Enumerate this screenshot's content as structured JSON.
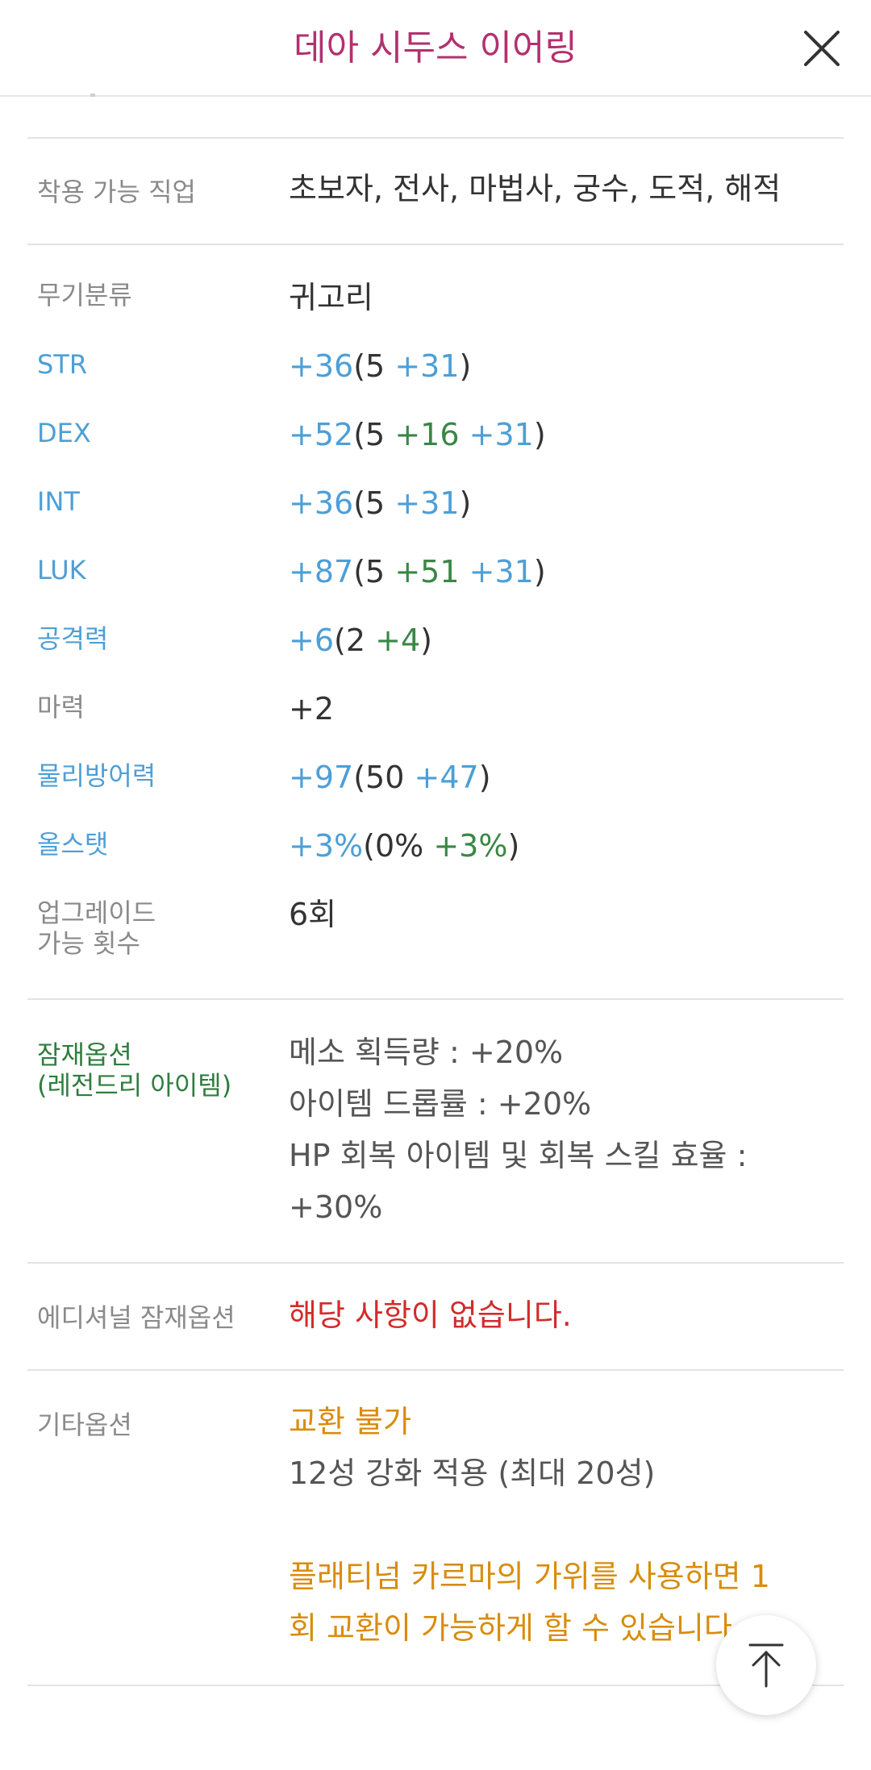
{
  "header": {
    "title": "데아 시두스 이어링"
  },
  "jobs": {
    "label": "착용 가능 직업",
    "value": "초보자, 전사, 마법사, 궁수, 도적, 해적"
  },
  "weapon_type": {
    "label": "무기분류",
    "value": "귀고리"
  },
  "str": {
    "label": "STR",
    "total": "+36",
    "open": "(",
    "base": "5",
    "bonus1": "+31",
    "close": ")"
  },
  "dex": {
    "label": "DEX",
    "total": "+52",
    "open": "(",
    "base": "5",
    "bonus_green": "+16",
    "bonus_blue": "+31",
    "close": ")"
  },
  "int": {
    "label": "INT",
    "total": "+36",
    "open": "(",
    "base": "5",
    "bonus1": "+31",
    "close": ")"
  },
  "luk": {
    "label": "LUK",
    "total": "+87",
    "open": "(",
    "base": "5",
    "bonus_green": "+51",
    "bonus_blue": "+31",
    "close": ")"
  },
  "attack": {
    "label": "공격력",
    "total": "+6",
    "open": "(",
    "base": "2",
    "bonus_green": "+4",
    "close": ")"
  },
  "magic": {
    "label": "마력",
    "value": "+2"
  },
  "defense": {
    "label": "물리방어력",
    "total": "+97",
    "open": "(",
    "base": "50",
    "bonus_blue": "+47",
    "close": ")"
  },
  "allstat": {
    "label": "올스탯",
    "total": "+3%",
    "open": "(",
    "base": "0%",
    "bonus_green": "+3%",
    "close": ")"
  },
  "upgrade": {
    "label_line1": "업그레이드",
    "label_line2": "가능 횟수",
    "value": "6회"
  },
  "potential": {
    "label_line1": "잠재옵션",
    "label_line2": "(레전드리 아이템)",
    "lines": [
      "메소 획득량 : +20%",
      "아이템 드롭률 : +20%",
      "HP 회복 아이템 및 회복 스킬 효율 :",
      "+30%"
    ]
  },
  "additional": {
    "label": "에디셔널 잠재옵션",
    "value": "해당 사항이 없습니다."
  },
  "etc": {
    "label": "기타옵션",
    "trade": "교환 불가",
    "star": "12성 강화 적용 (최대 20성)",
    "karma_line1": "플래티넘 카르마의 가위를 사용하면 1",
    "karma_line2": "회 교환이 가능하게 할 수 있습니다."
  },
  "icons": {
    "close": "close-icon",
    "scroll_top": "arrow-up-icon"
  }
}
